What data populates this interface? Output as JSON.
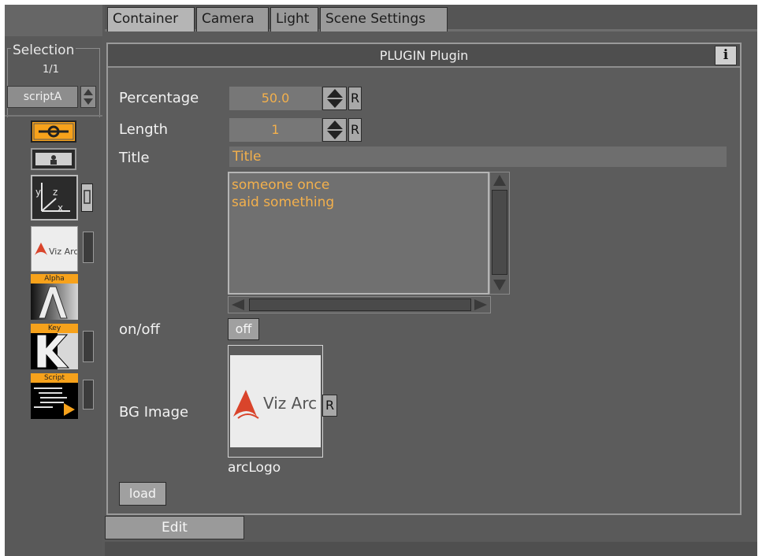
{
  "tabs": [
    {
      "label": "Container",
      "active": true
    },
    {
      "label": "Camera",
      "active": false
    },
    {
      "label": "Light",
      "active": false
    },
    {
      "label": "Scene Settings",
      "active": false
    }
  ],
  "selection": {
    "title": "Selection",
    "count": "1/1",
    "name": "scriptA"
  },
  "left_icons": {
    "viz_logo_text": "Viz Arc",
    "alpha_label": "Alpha",
    "key_label": "Key",
    "script_label": "Script",
    "axis_letters": {
      "y": "y",
      "z": "z",
      "x": "x"
    }
  },
  "panel": {
    "title": "PLUGIN Plugin",
    "info_label": "i",
    "percentage": {
      "label": "Percentage",
      "value": "50.0",
      "reset": "R"
    },
    "length": {
      "label": "Length",
      "value": "1",
      "reset": "R"
    },
    "title_field": {
      "label": "Title",
      "value": "Title"
    },
    "text_value": "someone once\nsaid something",
    "onoff": {
      "label": "on/off",
      "value": "off"
    },
    "bg_image": {
      "label": "BG Image",
      "logo_text": "Viz Arc",
      "reset": "R",
      "name": "arcLogo"
    },
    "load_label": "load"
  },
  "edit_label": "Edit",
  "colors": {
    "value_orange": "#f3b04c",
    "panel_bg": "#5c5c5c",
    "logo_red": "#d9442b"
  }
}
